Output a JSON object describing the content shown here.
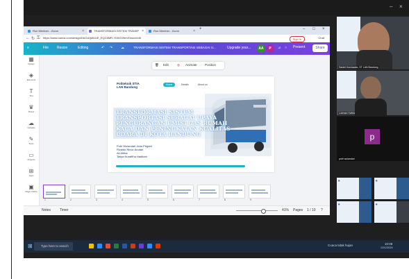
{
  "browser": {
    "tabs": [
      {
        "label": "Run Member - Zoom",
        "active": false
      },
      {
        "label": "TRANSFORMASI SISTEM TRANSP",
        "active": true
      },
      {
        "label": "Run Member - Zoom",
        "active": false
      }
    ],
    "url": "https://www.canva.com/design/DAGdJjsh1UE_EQC6MR-YDWG/9mVl1wxx/edit",
    "signin_label": "Sign in",
    "chat_label": "Chat"
  },
  "canva": {
    "menu": [
      "File",
      "Resize",
      "Editing"
    ],
    "doc_title": "TRANSFORMASI SISTEM TRANSPORTASI SEBAGAI U...",
    "upgrade_label": "Upgrade your...",
    "avatar_initials": "AA",
    "avatar2_initial": "P",
    "present_label": "Present",
    "share_label": "Share",
    "sidebar": [
      "Design",
      "Elements",
      "Text",
      "Brand",
      "Uploads",
      "Tools",
      "Projects",
      "Apps",
      "Magic Media"
    ],
    "edit_toolbar": {
      "edit": "Edit",
      "animate": "Animate",
      "position": "Position"
    },
    "slide": {
      "logo": "Politeknik STIA LAN Bandung",
      "nav": [
        "Home",
        "Details",
        "About us"
      ],
      "title": "TRANSFORMASI SISTEM TRANSPORTASI SEBAGAI UPAYA PENGURANGAN EMISI GAS RUMAH KACA DAN PENINGKATAN KUALITAS UDARA DI KOTA BANDUNG",
      "names": [
        "Putri Wulandari Jelar Pegatri",
        "Rivaldo Rinov Anotari",
        "Ali Akbar",
        "Tasya Nurafifha Hadibah"
      ]
    },
    "thumbnails": [
      "1",
      "2",
      "3",
      "4",
      "5",
      "6",
      "7",
      "8",
      "9"
    ],
    "status": {
      "notes": "Notes",
      "timer": "Timer",
      "zoom": "41%",
      "pages": "Pages",
      "page_count": "1 / 10"
    }
  },
  "participants": [
    {
      "name": "Daniel Kurniawan, ST LAN Bandung",
      "type": "video"
    },
    {
      "name": "Lukman Hafidz",
      "type": "video"
    },
    {
      "name": "putri wulandari",
      "type": "avatar",
      "initial": "p",
      "color": "#8e2a8e"
    }
  ],
  "taskbar": {
    "search_placeholder": "Type here to search",
    "weather": "Cuaca tidak hujan",
    "time": "10:08",
    "date": "12/12/2024"
  },
  "colors": {
    "canva_start": "#17b3c9",
    "canva_end": "#7b3fe4",
    "accent": "#1fb3c6",
    "taskbar": "#1b2a3d"
  }
}
